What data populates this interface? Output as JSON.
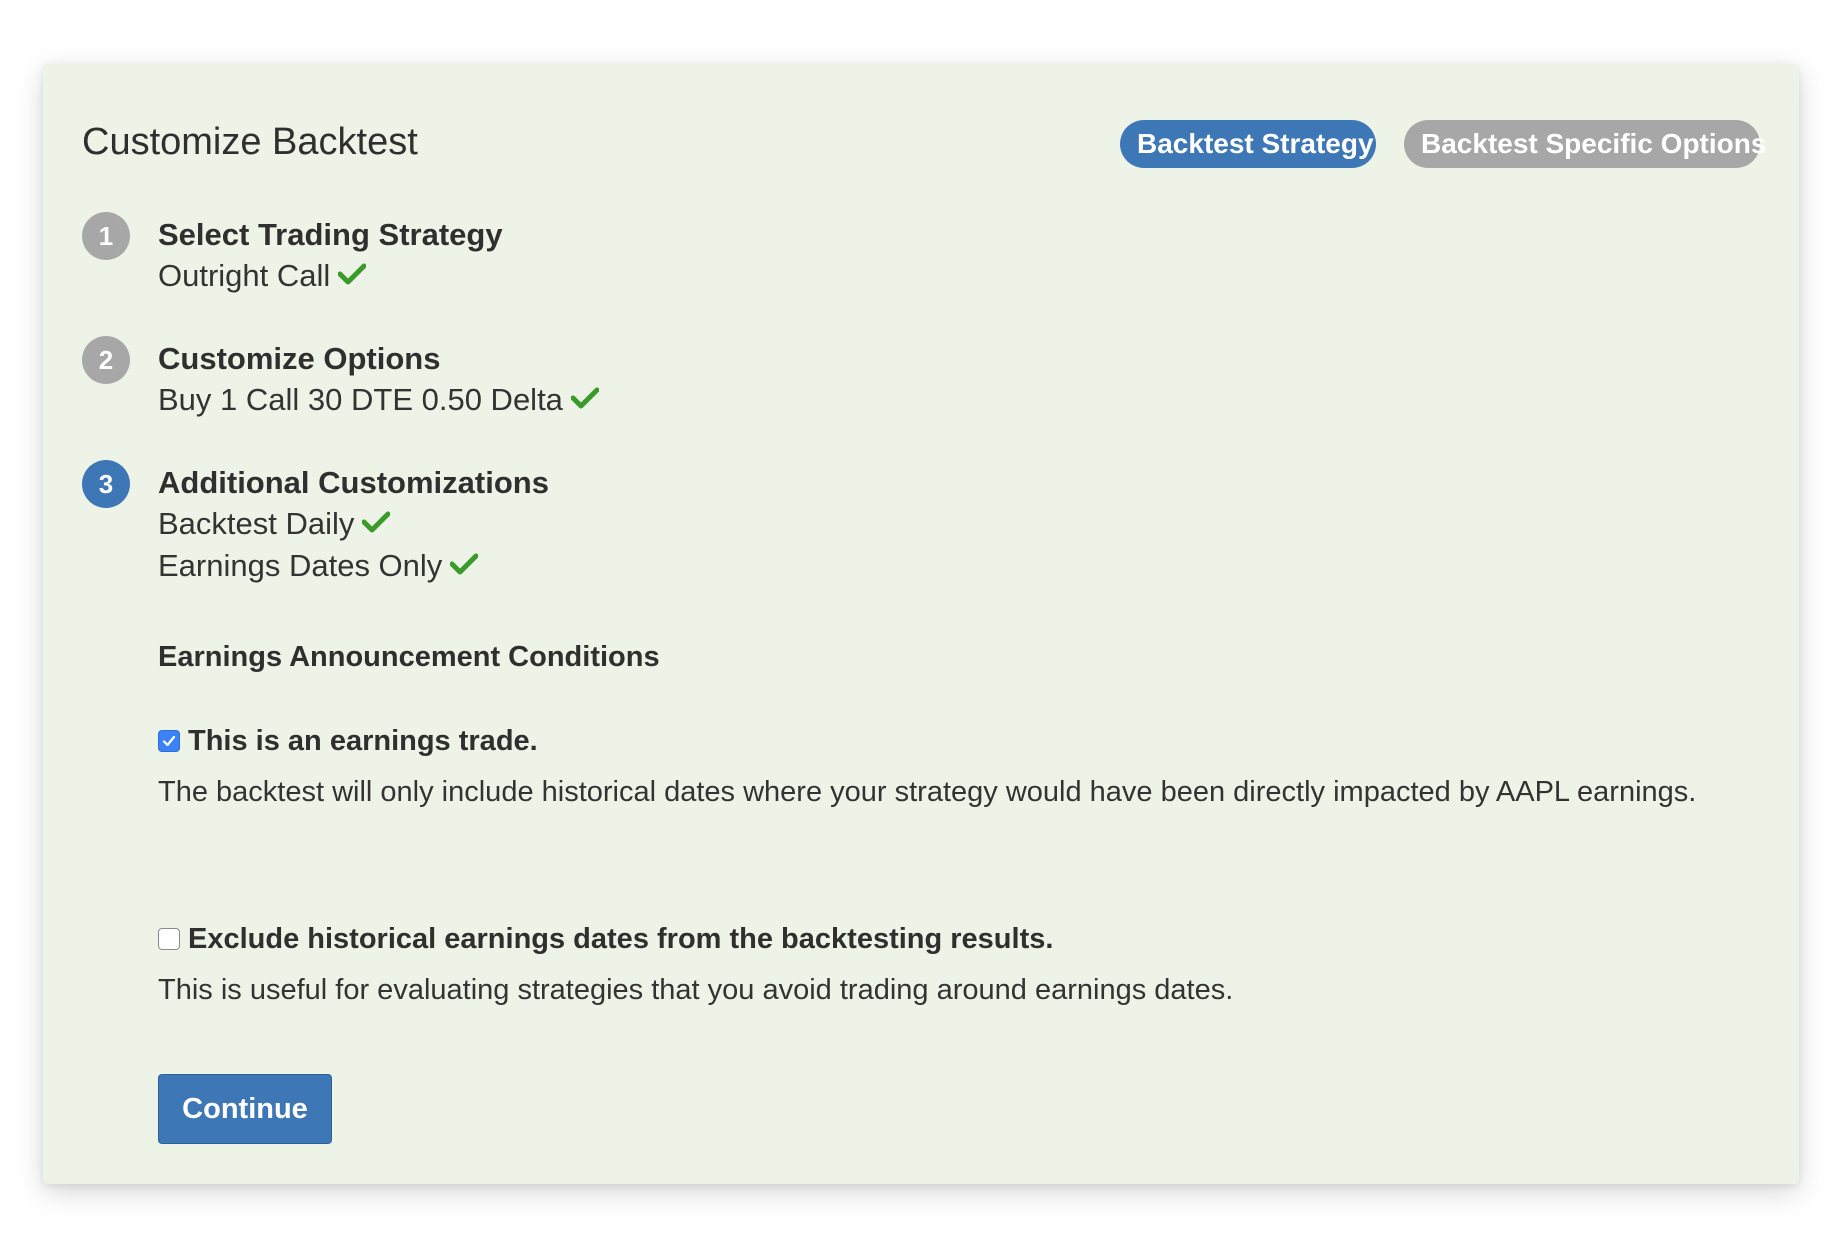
{
  "header": {
    "title": "Customize Backtest",
    "pills": [
      {
        "label": "Backtest Strategy",
        "active": true
      },
      {
        "label": "Backtest Specific Options",
        "active": false
      }
    ]
  },
  "steps": [
    {
      "number": "1",
      "title": "Select Trading Strategy",
      "values": [
        "Outright Call"
      ],
      "state": "done"
    },
    {
      "number": "2",
      "title": "Customize Options",
      "values": [
        "Buy 1 Call 30 DTE 0.50 Delta"
      ],
      "state": "done"
    },
    {
      "number": "3",
      "title": "Additional Customizations",
      "values": [
        "Backtest Daily",
        "Earnings Dates Only"
      ],
      "state": "active"
    }
  ],
  "earnings": {
    "section_title": "Earnings Announcement Conditions",
    "options": [
      {
        "label": "This is an earnings trade.",
        "checked": true,
        "description": "The backtest will only include historical dates where your strategy would have been directly impacted by AAPL earnings."
      },
      {
        "label": "Exclude historical earnings dates from the backtesting results.",
        "checked": false,
        "description": "This is useful for evaluating strategies that you avoid trading around earnings dates."
      }
    ]
  },
  "actions": {
    "continue_label": "Continue"
  },
  "colors": {
    "panel_background": "#edf4e7",
    "accent_blue": "#3e77b6",
    "inactive_gray": "#a7a7a7",
    "check_green": "#3a9a2a",
    "checkbox_blue": "#3b82f6"
  },
  "icons": {
    "check": "checkmark-icon",
    "checkbox_tick": "checkbox-tick-icon"
  }
}
